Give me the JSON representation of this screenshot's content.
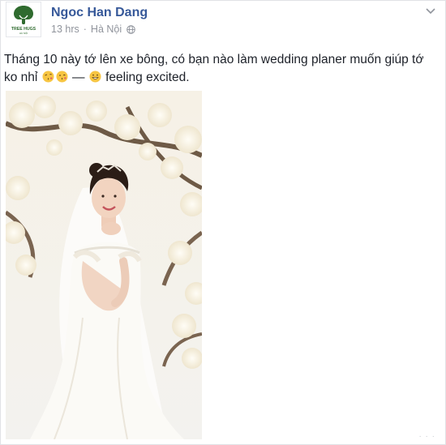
{
  "post": {
    "author_name": "Ngoc Han Dang",
    "timestamp": "13 hrs",
    "separator": "·",
    "location": "Hà Nội",
    "audience_icon": "globe-icon",
    "menu_icon": "chevron-down-icon",
    "avatar": {
      "logo_text": "TREE HUGS",
      "logo_subtext": "HÀ NỘI",
      "brand_color": "#2f6b2f"
    },
    "text_before_emoji": "Tháng 10 này tớ lên xe bông, có bạn nào làm wedding planer muốn giúp tớ ko nhỉ",
    "emoji_1": "kissing-face-emoji",
    "emoji_2": "kissing-face-emoji",
    "dash": "—",
    "feeling_emoji": "grinning-face-emoji",
    "feeling_text": "feeling excited.",
    "photo": {
      "subject": "bride-in-white-wedding-dress-photo"
    }
  },
  "colors": {
    "author_link": "#365899",
    "meta_text": "#90949c",
    "body_text": "#1d2129",
    "emoji_yellow": "#f7c542"
  }
}
